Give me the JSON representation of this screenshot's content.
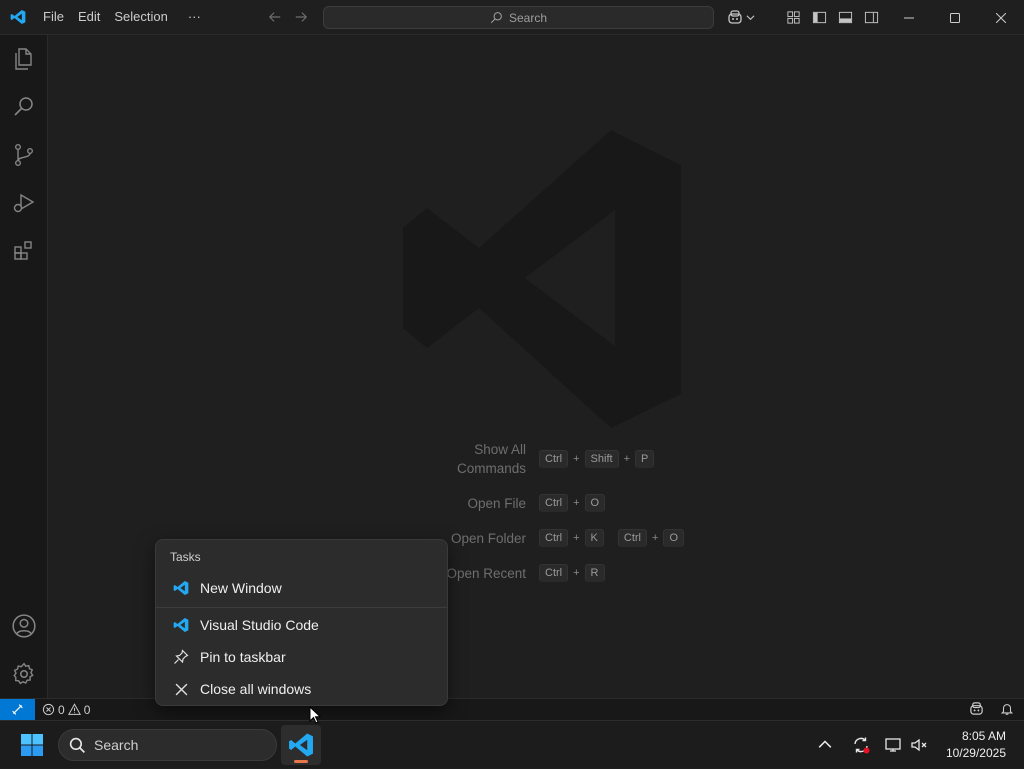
{
  "titlebar": {
    "menu": [
      "File",
      "Edit",
      "Selection",
      "···"
    ],
    "search_placeholder": "Search"
  },
  "activity_bar": {
    "top_items": [
      "explorer-icon",
      "search-icon",
      "source-control-icon",
      "run-debug-icon",
      "extensions-icon"
    ],
    "bottom_items": [
      "account-icon",
      "manage-gear-icon"
    ]
  },
  "welcome": {
    "shortcuts": [
      {
        "label_line1": "Show All",
        "label_line2": "Commands",
        "keys": [
          "Ctrl",
          "+",
          "Shift",
          "+",
          "P"
        ]
      },
      {
        "label_line1": "Open File",
        "label_line2": "",
        "keys": [
          "Ctrl",
          "+",
          "O"
        ]
      },
      {
        "label_line1": "Open Folder",
        "label_line2": "",
        "keys": [
          "Ctrl",
          "+",
          "K",
          " ",
          "Ctrl",
          "+",
          "O"
        ]
      },
      {
        "label_line1": "Open Recent",
        "label_line2": "",
        "keys": [
          "Ctrl",
          "+",
          "R"
        ]
      }
    ]
  },
  "statusbar": {
    "errors": "0",
    "warnings": "0"
  },
  "jumplist": {
    "title": "Tasks",
    "items": [
      {
        "label": "New Window",
        "icon": "vscode-icon"
      },
      {
        "label": "Visual Studio Code",
        "icon": "vscode-icon"
      },
      {
        "label": "Pin to taskbar",
        "icon": "pin-icon"
      },
      {
        "label": "Close all windows",
        "icon": "close-icon"
      }
    ]
  },
  "taskbar": {
    "search_label": "Search",
    "time": "8:05 AM",
    "date": "10/29/2025"
  },
  "colors": {
    "accent": "#0078d4",
    "vscode_blue": "#23a9f2",
    "taskbar_indicator": "#e8764b"
  }
}
